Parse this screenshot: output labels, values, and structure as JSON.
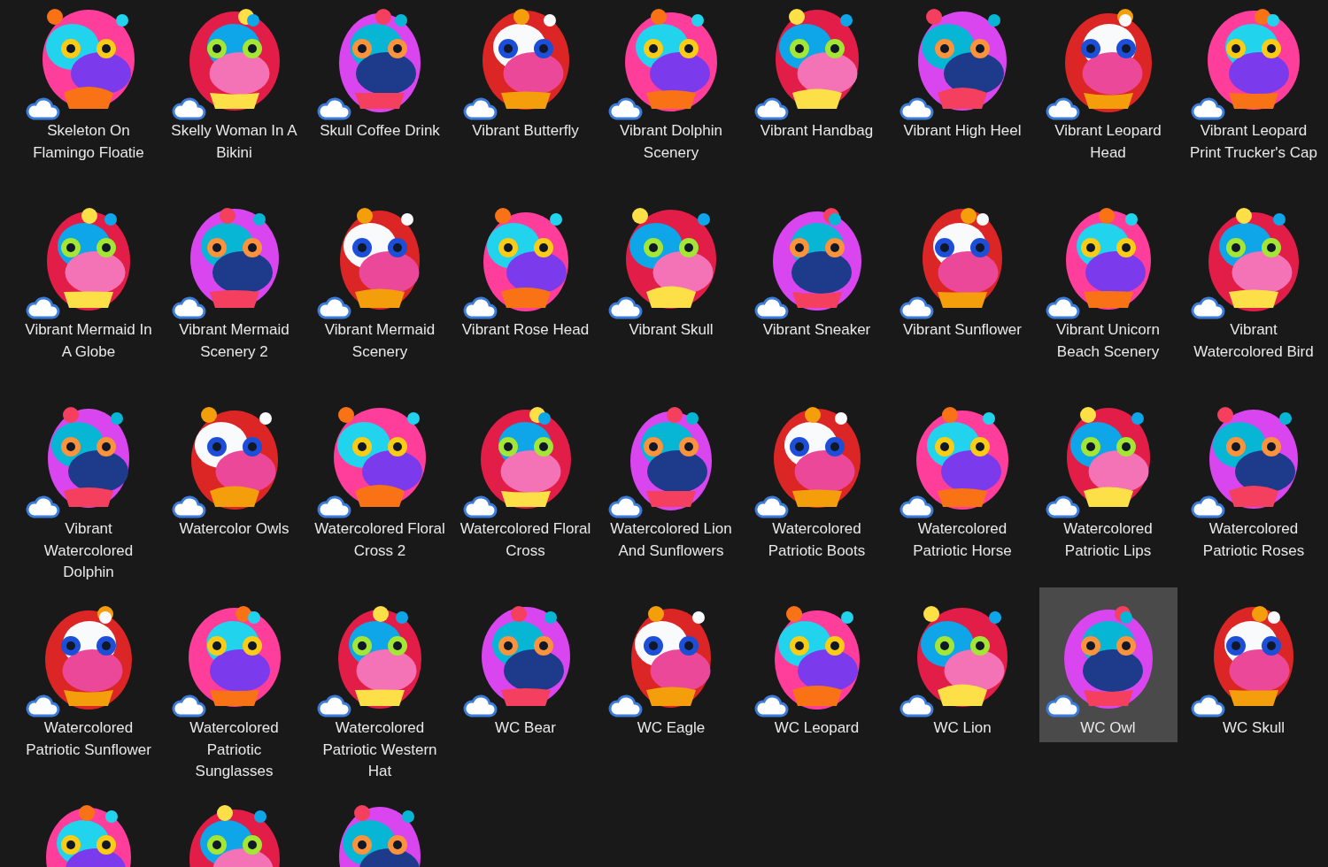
{
  "items": [
    {
      "label": "Skeleton On Flamingo Floatie",
      "selected": false
    },
    {
      "label": "Skelly Woman In A Bikini",
      "selected": false
    },
    {
      "label": "Skull Coffee Drink",
      "selected": false
    },
    {
      "label": "Vibrant Butterfly",
      "selected": false
    },
    {
      "label": "Vibrant Dolphin Scenery",
      "selected": false
    },
    {
      "label": "Vibrant Handbag",
      "selected": false
    },
    {
      "label": "Vibrant High Heel",
      "selected": false
    },
    {
      "label": "Vibrant Leopard Head",
      "selected": false
    },
    {
      "label": "Vibrant Leopard Print Trucker's Cap",
      "selected": false
    },
    {
      "label": "Vibrant Mermaid In A Globe",
      "selected": false
    },
    {
      "label": "Vibrant Mermaid Scenery 2",
      "selected": false
    },
    {
      "label": "Vibrant Mermaid Scenery",
      "selected": false
    },
    {
      "label": "Vibrant Rose Head",
      "selected": false
    },
    {
      "label": "Vibrant Skull",
      "selected": false
    },
    {
      "label": "Vibrant Sneaker",
      "selected": false
    },
    {
      "label": "Vibrant Sunflower",
      "selected": false
    },
    {
      "label": "Vibrant Unicorn Beach Scenery",
      "selected": false
    },
    {
      "label": "Vibrant Watercolored Bird",
      "selected": false
    },
    {
      "label": "Vibrant Watercolored Dolphin",
      "selected": false
    },
    {
      "label": "Watercolor Owls",
      "selected": false
    },
    {
      "label": "Watercolored Floral Cross 2",
      "selected": false
    },
    {
      "label": "Watercolored Floral Cross",
      "selected": false
    },
    {
      "label": "Watercolored Lion And Sunflowers",
      "selected": false
    },
    {
      "label": "Watercolored Patriotic Boots",
      "selected": false
    },
    {
      "label": "Watercolored Patriotic Horse",
      "selected": false
    },
    {
      "label": "Watercolored Patriotic Lips",
      "selected": false
    },
    {
      "label": "Watercolored Patriotic Roses",
      "selected": false
    },
    {
      "label": "Watercolored Patriotic Sunflower",
      "selected": false
    },
    {
      "label": "Watercolored Patriotic Sunglasses",
      "selected": false
    },
    {
      "label": "Watercolored Patriotic Western Hat",
      "selected": false
    },
    {
      "label": "WC Bear",
      "selected": false
    },
    {
      "label": "WC Eagle",
      "selected": false
    },
    {
      "label": "WC Leopard",
      "selected": false
    },
    {
      "label": "WC Lion",
      "selected": false
    },
    {
      "label": "WC Owl",
      "selected": true
    },
    {
      "label": "WC Skull",
      "selected": false
    },
    {
      "selected": false
    },
    {
      "selected": false
    },
    {
      "selected": false
    }
  ]
}
